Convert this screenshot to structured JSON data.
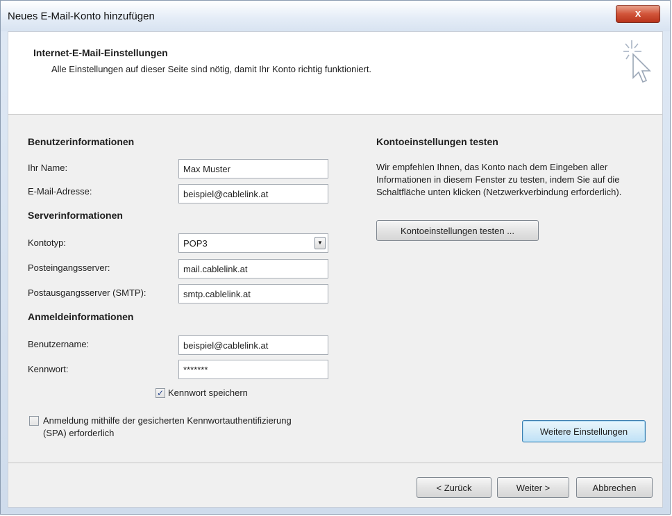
{
  "window": {
    "title": "Neues E-Mail-Konto hinzufügen",
    "close_label": "x"
  },
  "header": {
    "title": "Internet-E-Mail-Einstellungen",
    "subtitle": "Alle Einstellungen auf dieser Seite sind nötig, damit Ihr Konto richtig funktioniert.",
    "icon": "wizard-cursor-icon"
  },
  "user_info": {
    "heading": "Benutzerinformationen",
    "name_label": "Ihr Name:",
    "name_value": "Max Muster",
    "email_label": "E-Mail-Adresse:",
    "email_value": "beispiel@cablelink.at"
  },
  "server_info": {
    "heading": "Serverinformationen",
    "account_type_label": "Kontotyp:",
    "account_type_value": "POP3",
    "incoming_label": "Posteingangsserver:",
    "incoming_value": "mail.cablelink.at",
    "outgoing_label": "Postausgangsserver (SMTP):",
    "outgoing_value": "smtp.cablelink.at"
  },
  "login_info": {
    "heading": "Anmeldeinformationen",
    "username_label": "Benutzername:",
    "username_value": "beispiel@cablelink.at",
    "password_label": "Kennwort:",
    "password_value": "*******",
    "remember_label": "Kennwort speichern",
    "remember_checked": true,
    "spa_label_line1": "Anmeldung mithilfe der gesicherten Kennwortauthentifizierung",
    "spa_label_line2": "(SPA) erforderlich",
    "spa_checked": false
  },
  "test": {
    "heading": "Kontoeinstellungen testen",
    "description": "Wir empfehlen Ihnen, das Konto nach dem Eingeben aller Informationen in diesem Fenster zu testen, indem Sie auf die Schaltfläche unten klicken (Netzwerkverbindung erforderlich).",
    "button_label": "Kontoeinstellungen testen ..."
  },
  "more_settings_label": "Weitere Einstellungen",
  "footer": {
    "back_label": "< Zurück",
    "next_label": "Weiter >",
    "cancel_label": "Abbrechen"
  },
  "colors": {
    "close_red": "#c7432a",
    "focus_blue": "#3c7fb1",
    "panel": "#f0f0f0"
  }
}
